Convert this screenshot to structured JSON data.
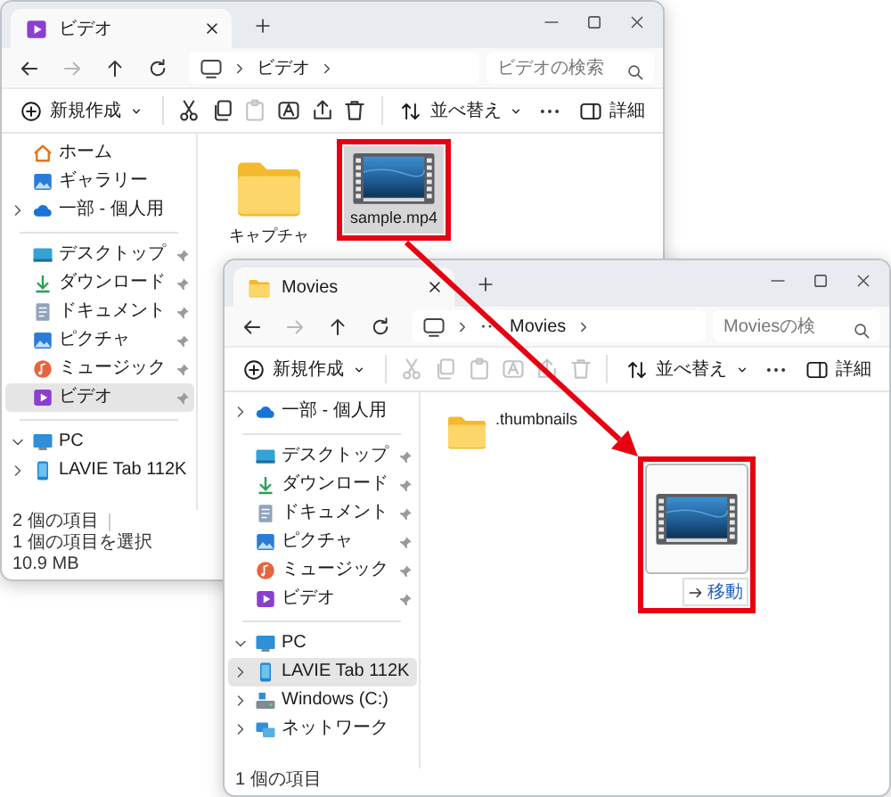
{
  "windows": [
    {
      "tab": {
        "kind": "videos",
        "title": "ビデオ"
      },
      "nav": [
        {
          "kind": "back",
          "disabled": false
        },
        {
          "kind": "forward",
          "disabled": true
        },
        {
          "kind": "up",
          "disabled": false
        },
        {
          "kind": "refresh",
          "disabled": false
        }
      ],
      "address": {
        "collapsed": false,
        "crumbs": [
          "ビデオ"
        ]
      },
      "search": {
        "placeholder": "ビデオの検索"
      },
      "toolbar": {
        "new_label": "新規作成",
        "actions": [
          {
            "kind": "cut",
            "disabled": false
          },
          {
            "kind": "copy",
            "disabled": false
          },
          {
            "kind": "paste",
            "disabled": true
          },
          {
            "kind": "rename",
            "disabled": false
          },
          {
            "kind": "share",
            "disabled": false
          },
          {
            "kind": "delete",
            "disabled": false
          }
        ],
        "sort_label": "並べ替え",
        "details_label": "詳細"
      },
      "sidebar": [
        {
          "kind": "home",
          "label": "ホーム",
          "pinned": false,
          "selected": false
        },
        {
          "kind": "gallery",
          "label": "ギャラリー",
          "pinned": false,
          "selected": false
        },
        {
          "kind": "cloud",
          "label": "一部 - 個人用",
          "expanded": false,
          "pinned": false,
          "selected": false
        },
        {
          "kind": "divider"
        },
        {
          "kind": "desktop",
          "label": "デスクトップ",
          "pinned": true,
          "selected": false
        },
        {
          "kind": "download",
          "label": "ダウンロード",
          "pinned": true,
          "selected": false
        },
        {
          "kind": "documents",
          "label": "ドキュメント",
          "pinned": true,
          "selected": false
        },
        {
          "kind": "pictures",
          "label": "ピクチャ",
          "pinned": true,
          "selected": false
        },
        {
          "kind": "music",
          "label": "ミュージック",
          "pinned": true,
          "selected": false
        },
        {
          "kind": "videos",
          "label": "ビデオ",
          "pinned": true,
          "selected": true
        },
        {
          "kind": "divider"
        },
        {
          "kind": "pc",
          "label": "PC",
          "expanded": true,
          "pinned": false,
          "selected": false
        },
        {
          "kind": "tablet",
          "label": "LAVIE Tab 112K",
          "expanded": false,
          "pinned": false,
          "selected": false
        }
      ],
      "files": [
        {
          "kind": "folder",
          "name": "キャプチャ",
          "selected": false,
          "highlighted": false
        },
        {
          "kind": "video",
          "name": "sample.mp4",
          "selected": true,
          "highlighted": true
        }
      ],
      "status": [
        "2 個の項目",
        "1 個の項目を選択",
        "10.9 MB"
      ]
    },
    {
      "tab": {
        "kind": "folder",
        "title": "Movies"
      },
      "nav": [
        {
          "kind": "back",
          "disabled": false
        },
        {
          "kind": "forward",
          "disabled": true
        },
        {
          "kind": "up",
          "disabled": false
        },
        {
          "kind": "refresh",
          "disabled": false
        }
      ],
      "address": {
        "collapsed": true,
        "crumbs": [
          "Movies"
        ]
      },
      "search": {
        "placeholder": "Moviesの検"
      },
      "toolbar": {
        "new_label": "新規作成",
        "actions": [
          {
            "kind": "cut",
            "disabled": true
          },
          {
            "kind": "copy",
            "disabled": true
          },
          {
            "kind": "paste",
            "disabled": true
          },
          {
            "kind": "rename",
            "disabled": true
          },
          {
            "kind": "share",
            "disabled": true
          },
          {
            "kind": "delete",
            "disabled": true
          }
        ],
        "sort_label": "並べ替え",
        "details_label": "詳細"
      },
      "sidebar": [
        {
          "kind": "cloud",
          "label": "一部 - 個人用",
          "expanded": false,
          "pinned": false,
          "selected": false
        },
        {
          "kind": "divider"
        },
        {
          "kind": "desktop",
          "label": "デスクトップ",
          "pinned": true,
          "selected": false
        },
        {
          "kind": "download",
          "label": "ダウンロード",
          "pinned": true,
          "selected": false
        },
        {
          "kind": "documents",
          "label": "ドキュメント",
          "pinned": true,
          "selected": false
        },
        {
          "kind": "pictures",
          "label": "ピクチャ",
          "pinned": true,
          "selected": false
        },
        {
          "kind": "music",
          "label": "ミュージック",
          "pinned": true,
          "selected": false
        },
        {
          "kind": "videos",
          "label": "ビデオ",
          "pinned": true,
          "selected": false
        },
        {
          "kind": "divider"
        },
        {
          "kind": "pc",
          "label": "PC",
          "expanded": true,
          "pinned": false,
          "selected": false
        },
        {
          "kind": "tablet",
          "label": "LAVIE Tab 112K",
          "expanded": false,
          "pinned": false,
          "selected": true
        },
        {
          "kind": "drive",
          "label": "Windows (C:)",
          "expanded": false,
          "pinned": false,
          "selected": false
        },
        {
          "kind": "network",
          "label": "ネットワーク",
          "expanded": false,
          "pinned": false,
          "selected": false
        }
      ],
      "files": [
        {
          "kind": "folder",
          "name": ".thumbnails",
          "selected": false,
          "highlighted": false
        }
      ],
      "drag": {
        "badge": "移動",
        "highlighted": true
      },
      "status": [
        "1 個の項目"
      ]
    }
  ]
}
